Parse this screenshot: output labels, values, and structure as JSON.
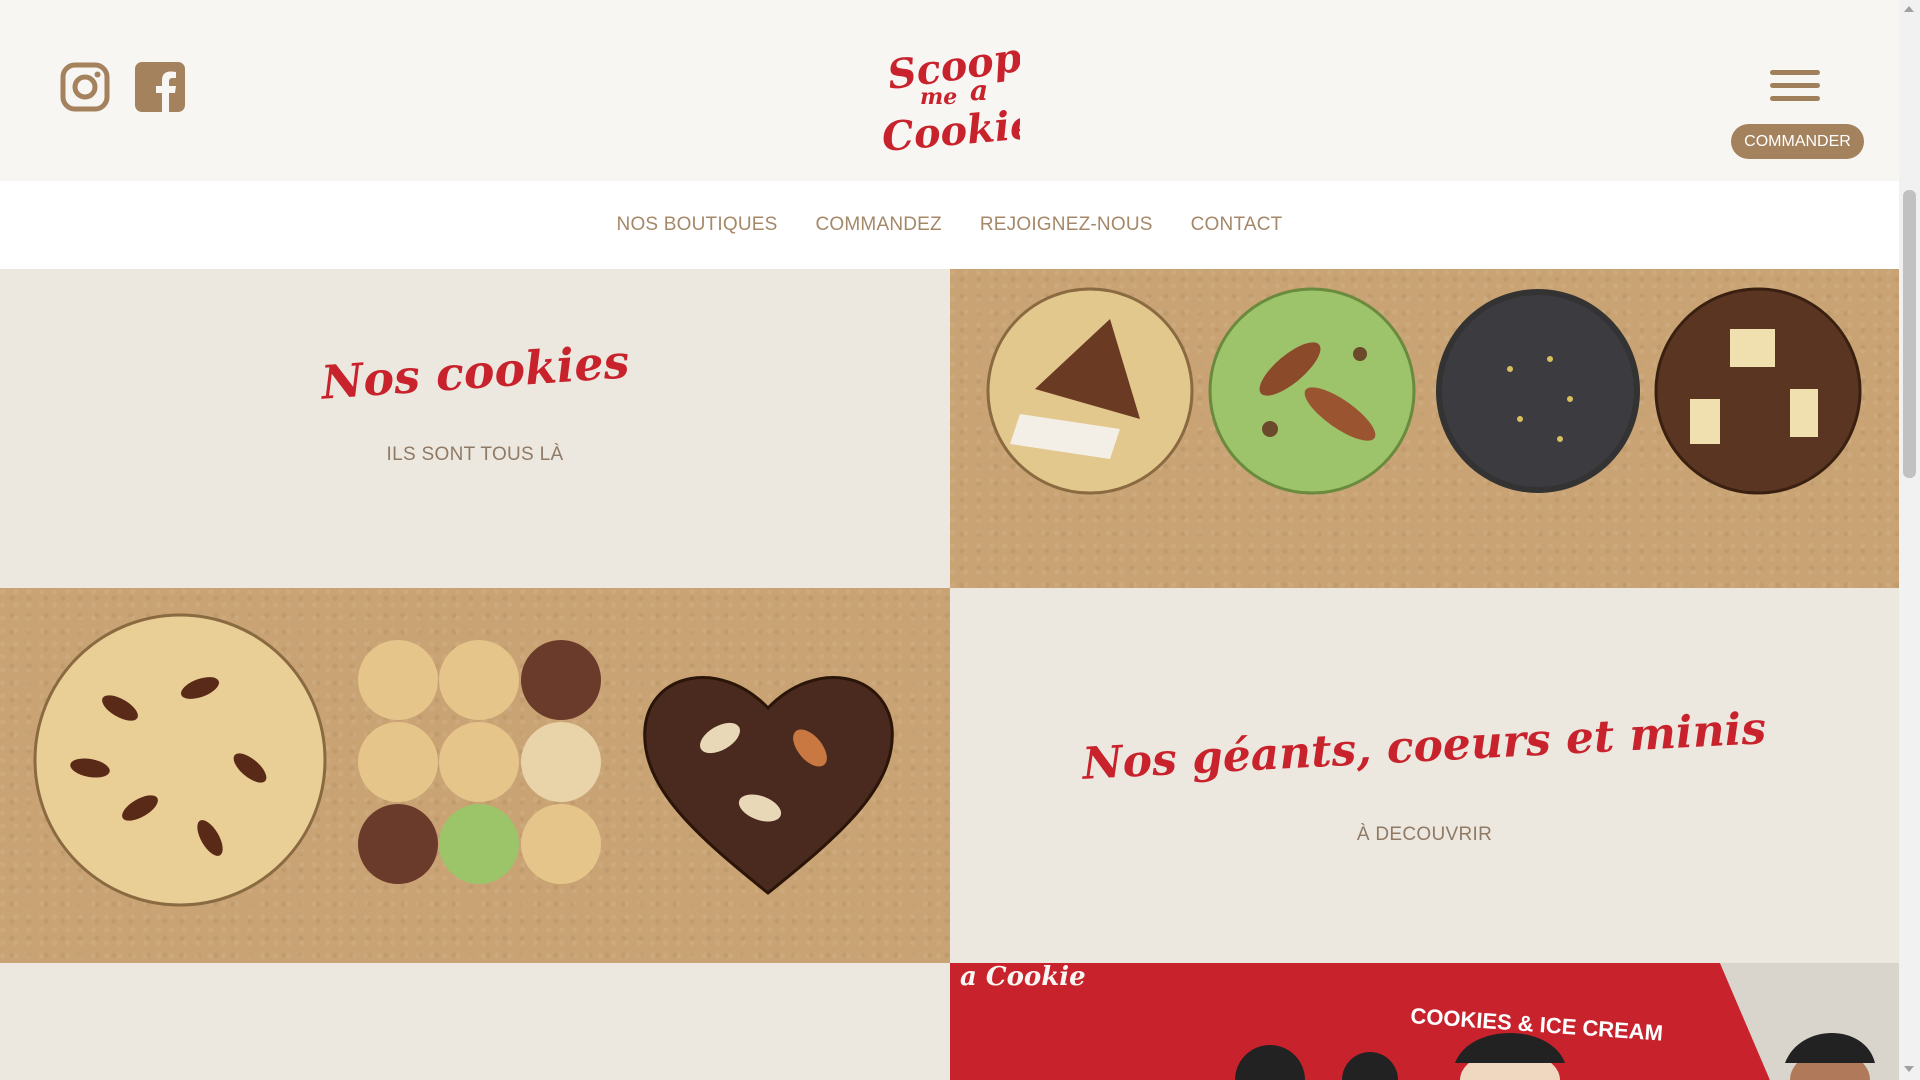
{
  "header": {
    "social": [
      {
        "icon": "instagram-icon"
      },
      {
        "icon": "facebook-icon"
      }
    ],
    "logo_text": "Scoop me a Cookie",
    "order_label": "COMMANDER"
  },
  "nav": {
    "items": [
      "NOS BOUTIQUES",
      "COMMANDEZ",
      "REJOIGNEZ-NOUS",
      "CONTACT"
    ]
  },
  "sections": [
    {
      "title": "Nos cookies",
      "subtitle": "ILS SONT TOUS LÀ"
    },
    {
      "title": "Nos géants, coeurs et minis",
      "subtitle": "À DECOUVRIR"
    }
  ],
  "storefront": {
    "awning_text": "COOKIES & ICE CREAM",
    "sign_text": "a Cookie"
  },
  "colors": {
    "brand_red": "#c8232c",
    "gold": "#a4825d",
    "text_muted": "#8f7a66",
    "background": "#ede8df"
  }
}
